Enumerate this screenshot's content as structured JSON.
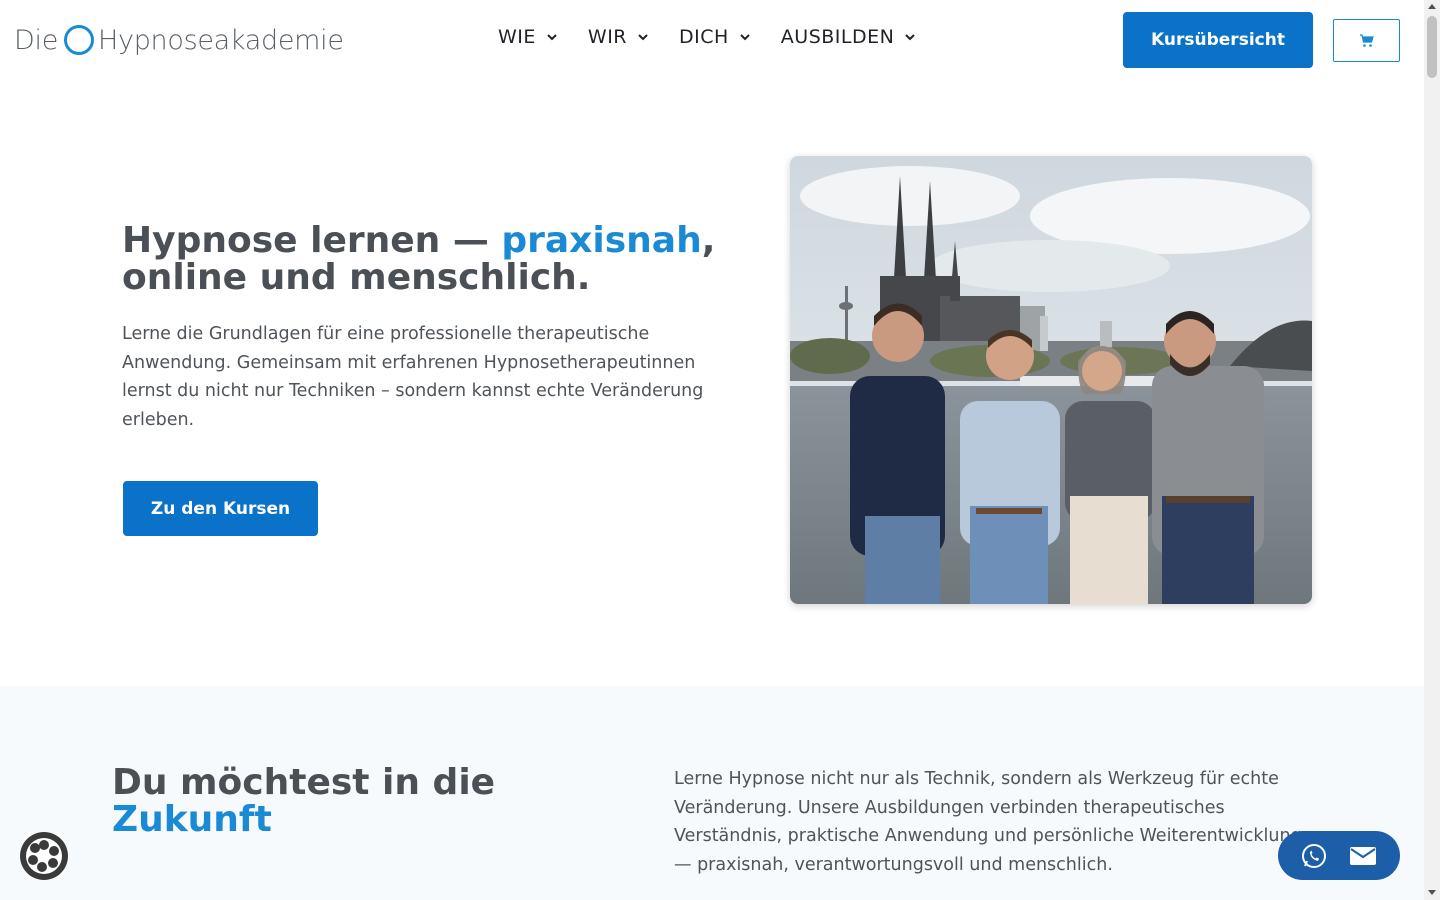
{
  "header": {
    "logo_prefix": "Die",
    "logo_name": "Hypnoseakademie",
    "nav": [
      {
        "label": "WIE"
      },
      {
        "label": "WIR"
      },
      {
        "label": "DICH"
      },
      {
        "label": "AUSBILDEN"
      }
    ],
    "cta_label": "Kursübersicht"
  },
  "hero": {
    "title_part1": "Hypnose lernen — ",
    "title_accent": "praxisnah",
    "title_part2": ",",
    "title_line2": "online und menschlich.",
    "text": "Lerne die Grundlagen für eine professionelle therapeutische Anwendung. Gemeinsam mit erfahrenen Hypnosetherapeutinnen lernst du nicht nur Techniken – sondern kannst  echte Veränderung erleben.",
    "button_label": "Zu den Kursen"
  },
  "section2": {
    "title_line1": "Du möchtest in die",
    "title_accent": "Zukunft",
    "text": "Lerne Hypnose nicht nur als Technik, sondern als Werkzeug für echte Veränderung. Unsere Ausbildungen verbinden therapeutisches Verständnis, praktische Anwendung und persönliche Weiterentwicklung — praxisnah, verantwortungsvoll und menschlich."
  },
  "colors": {
    "brand_blue": "#0a73c9",
    "accent_blue": "#1a8ad4",
    "text_gray": "#4b5057"
  },
  "icons": {
    "cart": "shopping-cart-icon",
    "whatsapp": "whatsapp-icon",
    "mail": "mail-icon",
    "cookie": "cookie-settings-icon"
  }
}
